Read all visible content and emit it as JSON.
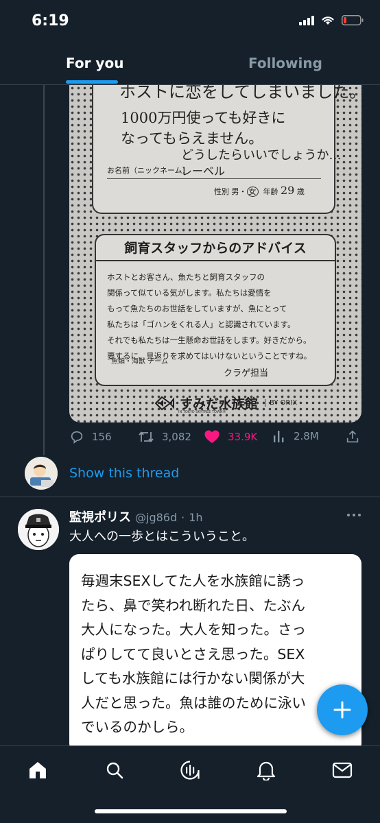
{
  "status_bar": {
    "time": "6:19",
    "battery_color": "#ff3b30"
  },
  "tabs": [
    {
      "label": "For you",
      "active": true
    },
    {
      "label": "Following",
      "active": false
    }
  ],
  "first_tweet": {
    "image": {
      "handwritten_lines": [
        "ホストに恋をしてしまいました。",
        "1000万円使っても好きに",
        "なってもらえません。",
        "どうしたらいいでしょうか…"
      ],
      "name_label": "お名前（ニックネーム）",
      "name_value": "レーベル",
      "gender_label": "性別 男・",
      "gender_value": "女",
      "age_label": "年齢",
      "age_value": "29",
      "age_unit": "歳",
      "advice_heading": "飼育スタッフからのアドバイス",
      "advice_lines": [
        "ホストとお客さん、魚たちと飼育スタッフの",
        "関係って似ている気がします。私たちは愛情を",
        "もって魚たちのお世話をしていますが、魚にとって",
        "私たちは「ゴハンをくれる人」と認識されています。",
        "それでも私たちは一生懸命お世話をします。好きだから。",
        "要するに、見返りを求めてはいけないということですね。"
      ],
      "team_label": "魚類・海獣 チーム",
      "signer": "クラゲ担当",
      "logo_text": "すみだ水族館",
      "logo_subtext": "IN TOKYO SKYTREE TOWN®",
      "logo_partner": "BY ORIX"
    },
    "actions": {
      "replies": "156",
      "retweets": "3,082",
      "likes": "33.9K",
      "views": "2.8M"
    },
    "colors": {
      "like_active": "#f91880",
      "action_gray": "#8899a6"
    }
  },
  "show_thread_label": "Show this thread",
  "second_tweet": {
    "author_name": "監視ポリス",
    "author_handle": "@jg86d",
    "separator": "·",
    "time": "1h",
    "text": "大人への一歩とはこういうこと。",
    "quote_lines": [
      "毎週末SEXしてた人を水族館に誘っ",
      "たら、鼻で笑われ断れた日、たぶん",
      "大人になった。大人を知った。さっ",
      "ぱりしてて良いとさえ思った。SEX",
      "しても水族館には行かない関係が大",
      "人だと思った。魚は誰のために泳い",
      "でいるのかしら。"
    ]
  },
  "fab": {
    "icon": "plus-icon",
    "color": "#1d9bf0"
  },
  "bottom_nav": {
    "items": [
      "home-icon",
      "search-icon",
      "spaces-icon",
      "notifications-icon",
      "messages-icon"
    ]
  },
  "theme": {
    "background": "#15202b",
    "accent": "#1d9bf0",
    "divider": "#38444d"
  }
}
